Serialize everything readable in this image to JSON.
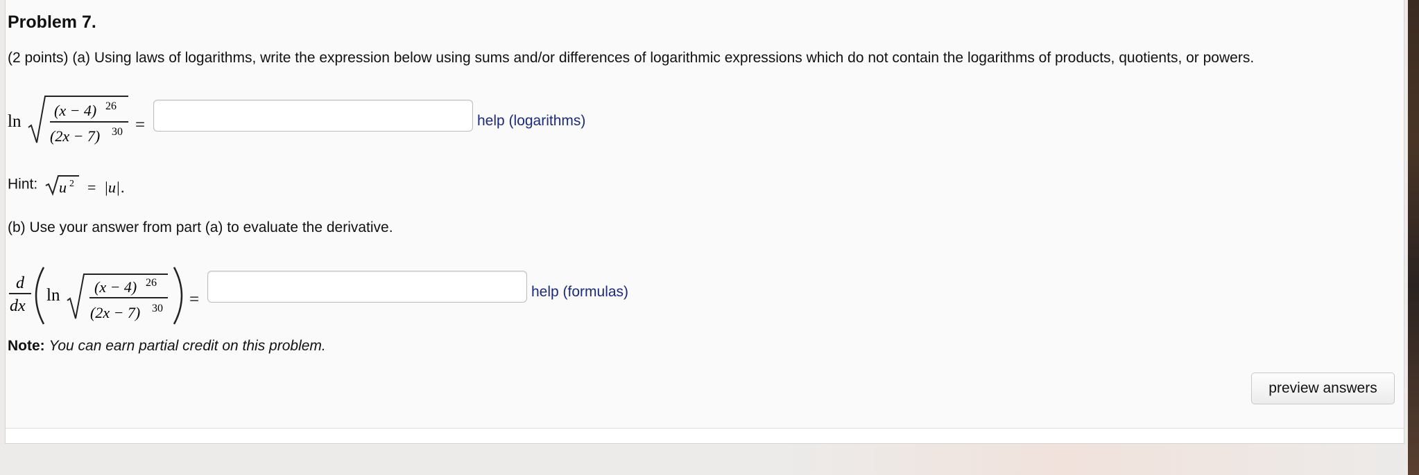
{
  "problem": {
    "title": "Problem 7.",
    "intro": "(2 points) (a) Using laws of logarithms, write the expression below using sums and/or differences of logarithmic expressions which do not contain the logarithms of products, quotients, or powers.",
    "part_a": {
      "ln": "ln",
      "numerator": "(x − 4)",
      "numerator_exp": "26",
      "denominator": "(2x − 7)",
      "denominator_exp": "30",
      "equals": "=",
      "answer_value": "",
      "help_label": "help (logarithms)"
    },
    "hint": {
      "label": "Hint:",
      "var": "u",
      "exp": "2",
      "equals": "=",
      "rhs": "|u|",
      "period": "."
    },
    "part_b": {
      "prompt": "(b) Use your answer from part (a) to evaluate the derivative.",
      "d": "d",
      "dx": "dx",
      "ln": "ln",
      "numerator": "(x − 4)",
      "numerator_exp": "26",
      "denominator": "(2x − 7)",
      "denominator_exp": "30",
      "equals": "=",
      "answer_value": "",
      "help_label": "help (formulas)"
    },
    "note": {
      "label": "Note:",
      "text": "You can earn partial credit on this problem."
    }
  },
  "buttons": {
    "preview_label": "preview answers"
  }
}
